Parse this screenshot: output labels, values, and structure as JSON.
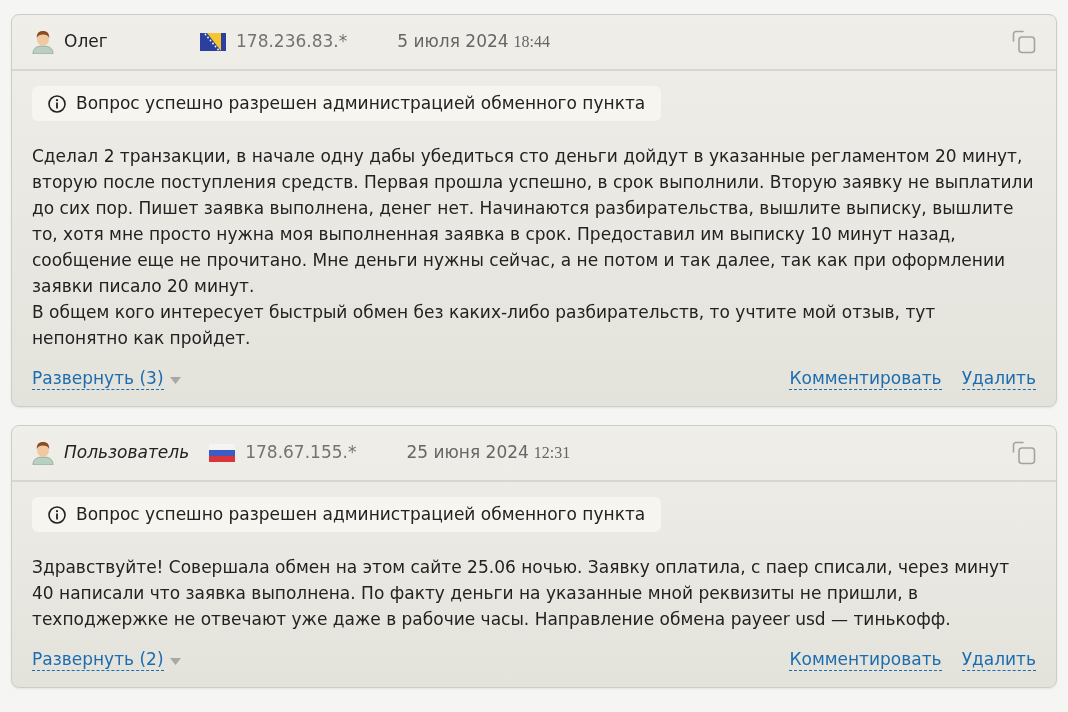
{
  "reviews": [
    {
      "author": {
        "name": "Олег",
        "kind": "registered"
      },
      "flag": {
        "kind": "ba"
      },
      "ip": "178.236.83.*",
      "date": "5 июля 2024",
      "time": "18:44",
      "notice": "Вопрос успешно разрешен администрацией обменного пункта",
      "paragraphs": [
        "Сделал 2 транзакции, в начале одну дабы убедиться сто деньги дойдут в указанные регламентом 20 минут, вторую после поступления средств. Первая прошла успешно, в срок выполнили. Вторую заявку не выплатили до сих пор. Пишет заявка выполнена, денег нет. Начинаются разбирательства, вышлите выписку, вышлите то, хотя мне просто нужна моя выполненная заявка в срок. Предоставил им выписку 10 минут назад, сообщение еще не прочитано. Мне деньги нужны сейчас, а не потом и так далее, так как при оформлении заявки писало 20 минут.",
        "В общем кого интересует быстрый обмен без каких-либо разбирательств, то учтите мой отзыв, тут непонятно как пройдет."
      ],
      "expand": "Развернуть (3)",
      "actions": [
        "Комментировать",
        "Удалить"
      ]
    },
    {
      "author": {
        "name": "Пользователь",
        "kind": "guest"
      },
      "flag": {
        "kind": "ru"
      },
      "ip": "178.67.155.*",
      "date": "25 июня 2024",
      "time": "12:31",
      "notice": "Вопрос успешно разрешен администрацией обменного пункта",
      "paragraphs": [
        "Здравствуйте! Совершала обмен на этом сайте 25.06 ночью. Заявку оплатила, с паер списали, через минут 40 написали что заявка выполнена. По факту деньги на указанные мной реквизиты не пришли, в техподжержке не отвечают уже даже в рабочие часы. Направление обмена payeer usd — тинькофф."
      ],
      "expand": "Развернуть (2)",
      "actions": [
        "Комментировать",
        "Удалить"
      ]
    }
  ]
}
